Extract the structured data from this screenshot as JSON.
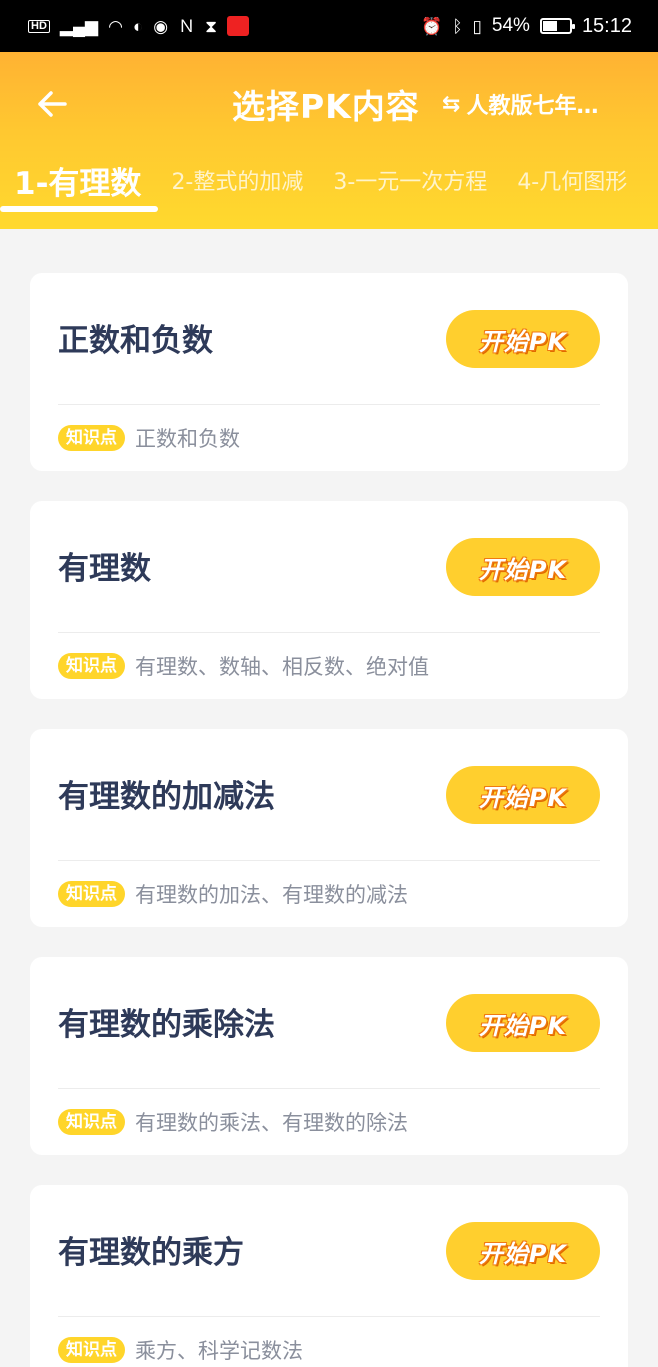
{
  "status_bar": {
    "left_icons": [
      "hd-icon",
      "signal-icon",
      "wifi-icon",
      "data-saver-icon",
      "eye-icon",
      "nfc-icon",
      "hourglass-icon",
      "app-notification-icon"
    ],
    "hd": "HD",
    "battery": "54%",
    "battery_level": 0.54,
    "time": "15:12"
  },
  "header": {
    "title": "选择PK内容",
    "edition": "人教版七年…",
    "tabs": [
      {
        "label": "1-有理数",
        "active": true
      },
      {
        "label": "2-整式的加减",
        "active": false
      },
      {
        "label": "3-一元一次方程",
        "active": false
      },
      {
        "label": "4-几何图形",
        "active": false
      }
    ]
  },
  "cards": [
    {
      "title": "正数和负数",
      "button": "开始PK",
      "badge": "知识点",
      "points": "正数和负数"
    },
    {
      "title": "有理数",
      "button": "开始PK",
      "badge": "知识点",
      "points": "有理数、数轴、相反数、绝对值"
    },
    {
      "title": "有理数的加减法",
      "button": "开始PK",
      "badge": "知识点",
      "points": "有理数的加法、有理数的减法"
    },
    {
      "title": "有理数的乘除法",
      "button": "开始PK",
      "badge": "知识点",
      "points": "有理数的乘法、有理数的除法"
    },
    {
      "title": "有理数的乘方",
      "button": "开始PK",
      "badge": "知识点",
      "points": "乘方、科学记数法"
    }
  ],
  "colors": {
    "header_top": "#ffb233",
    "header_bottom": "#ffd92e",
    "button": "#ffcf2e",
    "title_text": "#2e3a59",
    "muted_text": "#8a8f9c"
  }
}
